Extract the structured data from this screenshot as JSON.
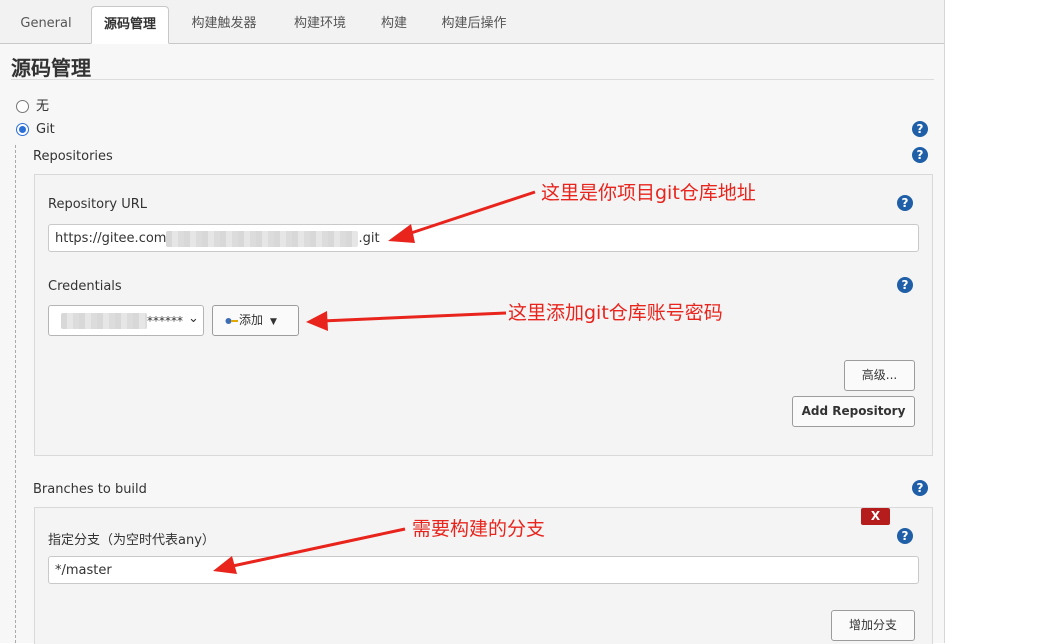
{
  "tabs": [
    {
      "label": "General",
      "active": false
    },
    {
      "label": "源码管理",
      "active": true
    },
    {
      "label": "构建触发器",
      "active": false
    },
    {
      "label": "构建环境",
      "active": false
    },
    {
      "label": "构建",
      "active": false
    },
    {
      "label": "构建后操作",
      "active": false
    }
  ],
  "section": {
    "title": "源码管理"
  },
  "scm": {
    "option_none": "无",
    "option_git": "Git",
    "selected": "Git"
  },
  "repositories": {
    "label": "Repositories",
    "url_label": "Repository URL",
    "url_prefix": "https://gitee.com",
    "url_suffix": ".git",
    "credentials_label": "Credentials",
    "credentials_value": "******",
    "add_button": "添加",
    "advanced_button": "高级...",
    "add_repository_button": "Add Repository"
  },
  "branches": {
    "label": "Branches to build",
    "specifier_label": "指定分支（为空时代表any）",
    "specifier_value": "*/master",
    "delete_label": "X",
    "add_branch_button": "增加分支"
  },
  "help_icon": "?",
  "annotations": {
    "repo_url": "这里是你项目git仓库地址",
    "credentials": "这里添加git仓库账号密码",
    "branch": "需要构建的分支"
  },
  "colors": {
    "annotation": "#e8241d",
    "help_icon": "#1f5fa8",
    "radio_selected": "#2b6fd8",
    "delete_button": "#b51c1c"
  }
}
